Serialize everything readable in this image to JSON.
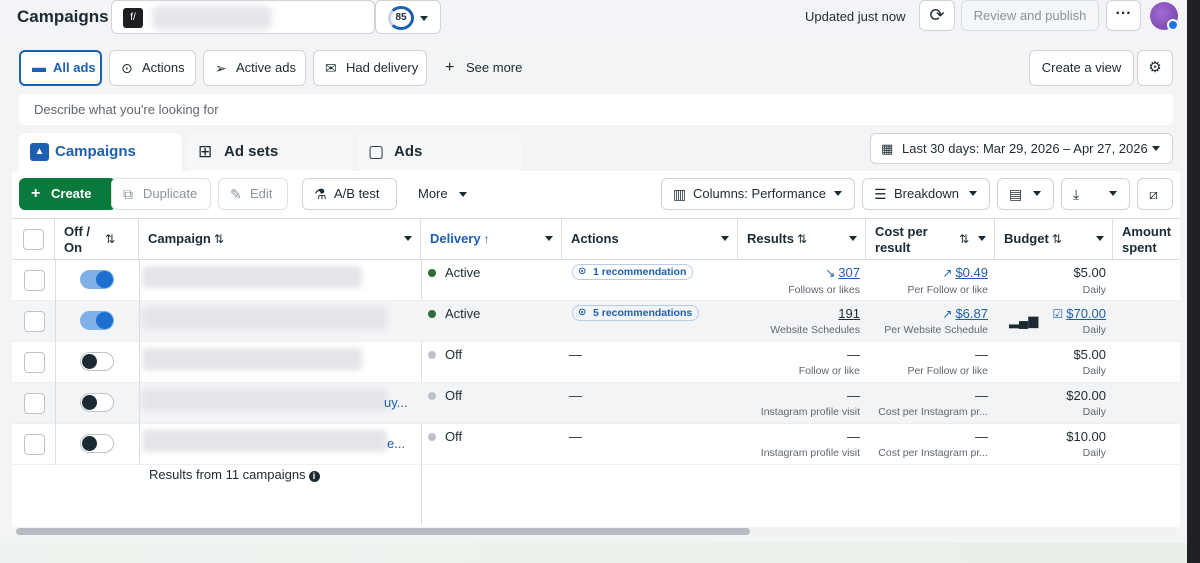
{
  "header": {
    "title": "Campaigns",
    "account_logo_text": "f/",
    "opportunity_score": "85",
    "updated_text": "Updated just now",
    "review_publish_label": "Review and publish",
    "more_label": "···"
  },
  "filters": {
    "all_ads": "All ads",
    "actions": "Actions",
    "active_ads": "Active ads",
    "had_delivery": "Had delivery",
    "see_more": "See more",
    "create_view": "Create a view"
  },
  "search": {
    "placeholder": "Describe what you're looking for"
  },
  "tabs": {
    "campaigns": "Campaigns",
    "ad_sets": "Ad sets",
    "ads": "Ads"
  },
  "date_range": "Last 30 days: Mar 29, 2026 – Apr 27, 2026",
  "toolbar": {
    "create": "Create",
    "duplicate": "Duplicate",
    "edit": "Edit",
    "ab_test": "A/B test",
    "more": "More",
    "columns": "Columns: Performance",
    "breakdown": "Breakdown"
  },
  "table": {
    "headers": {
      "off_on_1": "Off /",
      "off_on_2": "On",
      "campaign": "Campaign",
      "delivery": "Delivery",
      "actions": "Actions",
      "results": "Results",
      "cost_1": "Cost per",
      "cost_2": "result",
      "budget": "Budget",
      "amount_1": "Amount",
      "amount_2": "spent"
    },
    "rows": [
      {
        "on": true,
        "name_tail": "",
        "delivery": "Active",
        "action": "1 recommendation",
        "result": "307",
        "result_sub": "Follows or likes",
        "cost": "$0.49",
        "cost_sub": "Per Follow or like",
        "budget": "$5.00",
        "budget_sub": "Daily"
      },
      {
        "on": true,
        "name_tail": "",
        "delivery": "Active",
        "action": "5 recommendations",
        "result": "191",
        "result_sub": "Website Schedules",
        "cost": "$6.87",
        "cost_sub": "Per Website Schedule",
        "budget": "$70.00",
        "budget_sub": "Daily"
      },
      {
        "on": false,
        "name_tail": "",
        "delivery": "Off",
        "action": "—",
        "result": "—",
        "result_sub": "Follow or like",
        "cost": "—",
        "cost_sub": "Per Follow or like",
        "budget": "$5.00",
        "budget_sub": "Daily"
      },
      {
        "on": false,
        "name_tail": "uy...",
        "delivery": "Off",
        "action": "—",
        "result": "—",
        "result_sub": "Instagram profile visit",
        "cost": "—",
        "cost_sub": "Cost per Instagram pr...",
        "budget": "$20.00",
        "budget_sub": "Daily"
      },
      {
        "on": false,
        "name_tail": "e...",
        "delivery": "Off",
        "action": "—",
        "result": "—",
        "result_sub": "Instagram profile visit",
        "cost": "—",
        "cost_sub": "Cost per Instagram pr...",
        "budget": "$10.00",
        "budget_sub": "Daily"
      }
    ],
    "footer": "Results from 11 campaigns"
  },
  "colors": {
    "accent": "#1d5fb0",
    "create_green": "#0a7a3c",
    "active_dot": "#2e6b3a",
    "off_dot": "#bec3c9"
  }
}
